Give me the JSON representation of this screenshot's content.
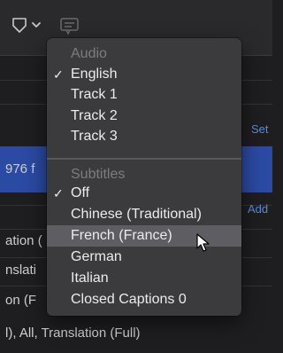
{
  "toolbar": {
    "icons": [
      "shield-outline-icon",
      "chevron-down-icon",
      "caption-bubble-icon"
    ]
  },
  "background": {
    "row_976": "976 f",
    "set_link": "Set",
    "add_link": "Add",
    "row_ation": "ation (",
    "row_nslati": "nslati",
    "row_on_f": "on (F",
    "row_bottom": "l), All, Translation (Full)"
  },
  "menu": {
    "audio_header": "Audio",
    "audio_items": [
      {
        "label": "English",
        "checked": true
      },
      {
        "label": "Track 1",
        "checked": false
      },
      {
        "label": "Track 2",
        "checked": false
      },
      {
        "label": "Track 3",
        "checked": false
      }
    ],
    "subtitles_header": "Subtitles",
    "subtitle_items": [
      {
        "label": "Off",
        "checked": true
      },
      {
        "label": "Chinese (Traditional)",
        "checked": false
      },
      {
        "label": "French (France)",
        "checked": false,
        "highlighted": true
      },
      {
        "label": "German",
        "checked": false
      },
      {
        "label": "Italian",
        "checked": false
      },
      {
        "label": "Closed Captions 0",
        "checked": false
      }
    ],
    "check_glyph": "✓"
  },
  "colors": {
    "selection_band": "#2b4aa3",
    "link": "#4d8ff0",
    "menu_bg": "#3b3b3e",
    "menu_highlight": "#5e5e62"
  }
}
